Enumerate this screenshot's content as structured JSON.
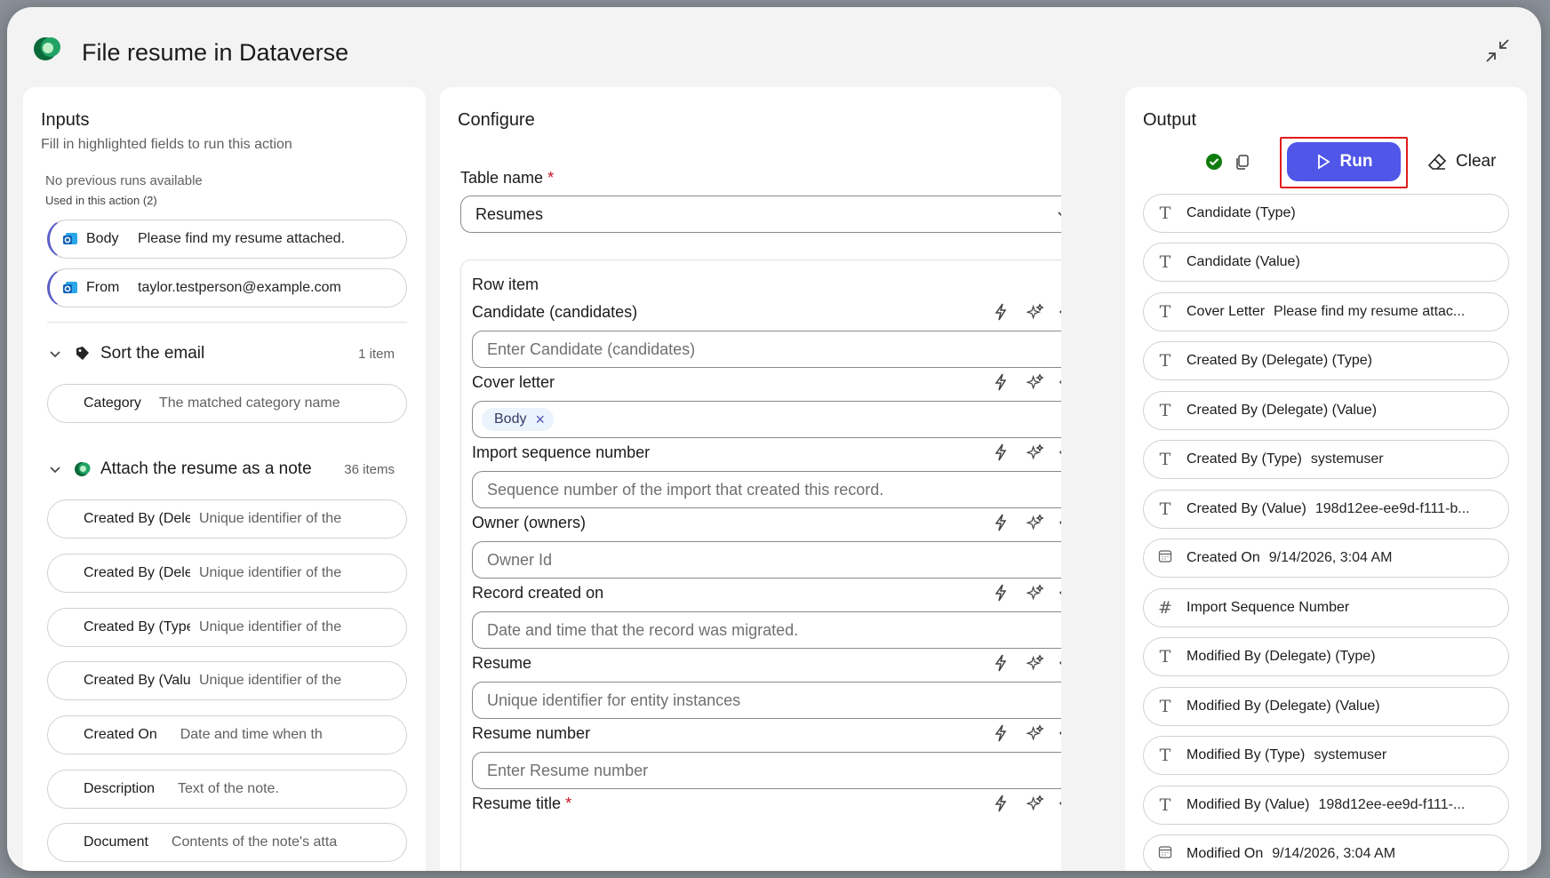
{
  "dialog": {
    "title": "File resume in Dataverse"
  },
  "inputs": {
    "title": "Inputs",
    "subtitle": "Fill in highlighted fields to run this action",
    "no_runs": "No previous runs available",
    "used_in": "Used in this action (2)",
    "used_fields": [
      {
        "label": "Body",
        "value": "Please find my resume attached."
      },
      {
        "label": "From",
        "value": "taylor.testperson@example.com"
      }
    ],
    "groups": [
      {
        "title": "Sort the email",
        "count": "1 item",
        "fields": [
          {
            "label": "Category",
            "hint": "The matched category name"
          }
        ]
      },
      {
        "title": "Attach the resume as a note",
        "count": "36 items",
        "fields": [
          {
            "label": "Created By (Delegate) (Type)",
            "hint": "Unique identifier of the"
          },
          {
            "label": "Created By (Delegate) (Value)",
            "hint": "Unique identifier of the"
          },
          {
            "label": "Created By (Type)",
            "hint": "Unique identifier of the"
          },
          {
            "label": "Created By (Value)",
            "hint": "Unique identifier of the"
          },
          {
            "label": "Created On",
            "hint": "Date and time when th"
          },
          {
            "label": "Description",
            "hint": "Text of the note."
          },
          {
            "label": "Document",
            "hint": "Contents of the note's atta"
          }
        ]
      }
    ]
  },
  "configure": {
    "title": "Configure",
    "table_name_label": "Table name",
    "required_mark": "*",
    "table_name_value": "Resumes",
    "row_item_label": "Row item",
    "fields": [
      {
        "label": "Candidate (candidates)",
        "placeholder": "Enter Candidate (candidates)"
      },
      {
        "label": "Cover letter",
        "token": "Body"
      },
      {
        "label": "Import sequence number",
        "placeholder": "Sequence number of the import that created this record."
      },
      {
        "label": "Owner (owners)",
        "placeholder": "Owner Id"
      },
      {
        "label": "Record created on",
        "placeholder": "Date and time that the record was migrated."
      },
      {
        "label": "Resume",
        "placeholder": "Unique identifier for entity instances"
      },
      {
        "label": "Resume number",
        "placeholder": "Enter Resume number"
      },
      {
        "label": "Resume title",
        "required": true
      }
    ]
  },
  "output": {
    "title": "Output",
    "run_label": "Run",
    "clear_label": "Clear",
    "accent_color": "#4f56e8",
    "items": [
      {
        "type": "text",
        "label": "Candidate (Type)",
        "value": ""
      },
      {
        "type": "text",
        "label": "Candidate (Value)",
        "value": ""
      },
      {
        "type": "text",
        "label": "Cover Letter",
        "value": "Please find my resume attac..."
      },
      {
        "type": "text",
        "label": "Created By (Delegate) (Type)",
        "value": ""
      },
      {
        "type": "text",
        "label": "Created By (Delegate) (Value)",
        "value": ""
      },
      {
        "type": "text",
        "label": "Created By (Type)",
        "value": "systemuser"
      },
      {
        "type": "text",
        "label": "Created By (Value)",
        "value": "198d12ee-ee9d-f111-b..."
      },
      {
        "type": "date",
        "label": "Created On",
        "value": "9/14/2026, 3:04 AM"
      },
      {
        "type": "number",
        "label": "Import Sequence Number",
        "value": ""
      },
      {
        "type": "text",
        "label": "Modified By (Delegate) (Type)",
        "value": ""
      },
      {
        "type": "text",
        "label": "Modified By (Delegate) (Value)",
        "value": ""
      },
      {
        "type": "text",
        "label": "Modified By (Type)",
        "value": "systemuser"
      },
      {
        "type": "text",
        "label": "Modified By (Value)",
        "value": "198d12ee-ee9d-f111-..."
      },
      {
        "type": "date",
        "label": "Modified On",
        "value": "9/14/2026, 3:04 AM"
      }
    ]
  }
}
